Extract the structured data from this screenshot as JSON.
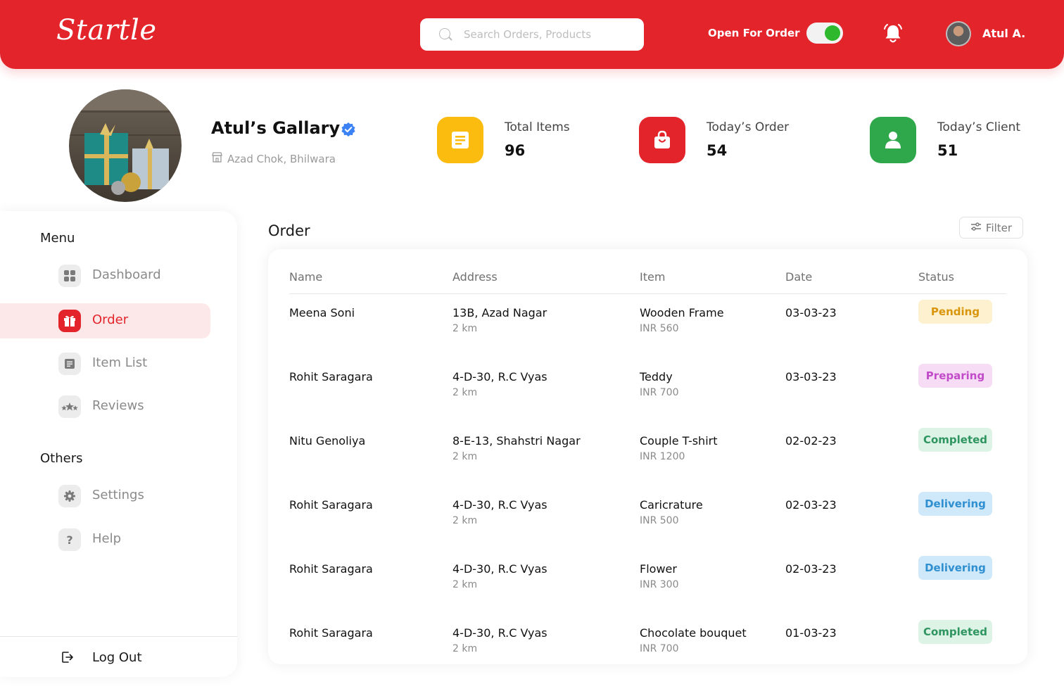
{
  "header": {
    "logo": "Startle",
    "search_placeholder": "Search Orders, Products",
    "open_label": "Open For Order",
    "user_name": "Atul A."
  },
  "profile": {
    "store_name": "Atul’s Gallary",
    "location": "Azad Chok, Bhilwara"
  },
  "stats": [
    {
      "label": "Total Items",
      "value": "96",
      "color": "#fbbc0f",
      "icon": "document-icon"
    },
    {
      "label": "Today’s Order",
      "value": "54",
      "color": "#e3242b",
      "icon": "shopping-bag-icon"
    },
    {
      "label": "Today’s Client",
      "value": "51",
      "color": "#2ea84a",
      "icon": "user-icon"
    }
  ],
  "sidebar": {
    "menu_heading": "Menu",
    "others_heading": "Others",
    "items": [
      {
        "label": "Dashboard"
      },
      {
        "label": "Order"
      },
      {
        "label": "Item List"
      },
      {
        "label": "Reviews"
      }
    ],
    "other_items": [
      {
        "label": "Settings"
      },
      {
        "label": "Help"
      }
    ],
    "logout_label": "Log Out"
  },
  "orders": {
    "title": "Order",
    "filter_label": "Filter",
    "columns": [
      "Name",
      "Address",
      "Item",
      "Date",
      "Status"
    ],
    "rows": [
      {
        "name": "Meena Soni",
        "address": "13B, Azad Nagar",
        "distance": "2 km",
        "item": "Wooden Frame",
        "price": "INR 560",
        "date": "03-03-23",
        "status": "Pending"
      },
      {
        "name": "Rohit Saragara",
        "address": "4-D-30, R.C Vyas",
        "distance": "2 km",
        "item": "Teddy",
        "price": "INR 700",
        "date": "03-03-23",
        "status": "Preparing"
      },
      {
        "name": "Nitu Genoliya",
        "address": "8-E-13, Shahstri Nagar",
        "distance": "2 km",
        "item": "Couple T-shirt",
        "price": "INR 1200",
        "date": "02-02-23",
        "status": "Completed"
      },
      {
        "name": "Rohit Saragara",
        "address": "4-D-30, R.C Vyas",
        "distance": "2 km",
        "item": "Caricrature",
        "price": "INR 500",
        "date": "02-03-23",
        "status": "Delivering"
      },
      {
        "name": "Rohit Saragara",
        "address": "4-D-30, R.C Vyas",
        "distance": "2 km",
        "item": "Flower",
        "price": "INR 300",
        "date": "02-03-23",
        "status": "Delivering"
      },
      {
        "name": "Rohit Saragara",
        "address": "4-D-30, R.C Vyas",
        "distance": "2 km",
        "item": "Chocolate bouquet",
        "price": "INR 700",
        "date": "01-03-23",
        "status": "Completed"
      }
    ]
  },
  "status_colors": {
    "Pending": {
      "bg": "#fdf1cf",
      "fg": "#d9960c"
    },
    "Preparing": {
      "bg": "#f7dcf5",
      "fg": "#c24bc9"
    },
    "Completed": {
      "bg": "#dcf3e6",
      "fg": "#2f9560"
    },
    "Delivering": {
      "bg": "#cfe9fa",
      "fg": "#2f8fd0"
    }
  },
  "colors": {
    "brand": "#e3242b",
    "toggle_on": "#2eb82e",
    "verified": "#3b82f6"
  }
}
